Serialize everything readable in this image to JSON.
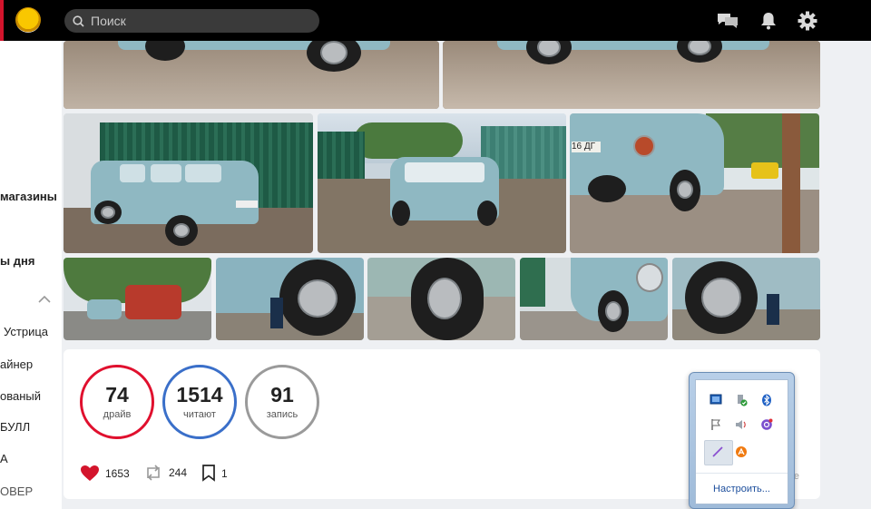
{
  "topbar": {
    "search_placeholder": "Поиск",
    "icons": [
      "logo-icon",
      "search-icon",
      "messages-icon",
      "bell-icon",
      "gear-icon"
    ]
  },
  "sidebar": {
    "items": [
      {
        "label": "магазины",
        "bold": true
      },
      {
        "label": "ы дня",
        "bold": true
      },
      {
        "label": "Устрица"
      },
      {
        "label": "айнер"
      },
      {
        "label": "ованый"
      },
      {
        "label": "БУЛЛ"
      },
      {
        "label": "А"
      },
      {
        "label": "ОВЕР"
      }
    ]
  },
  "gallery": {
    "photos": [
      "photo-car-top-left",
      "photo-car-top-right",
      "photo-car-fence-side",
      "photo-car-front-yard",
      "photo-car-rear",
      "photo-street-van",
      "photo-wheel-1",
      "photo-wheel-2",
      "photo-wheel-3",
      "photo-headlight",
      "photo-wheel-4"
    ],
    "plates": [
      "16 ДГ"
    ]
  },
  "stats": {
    "drives": {
      "value": "74",
      "label": "драйв",
      "color": "#e0102e"
    },
    "readers": {
      "value": "1514",
      "label": "читают",
      "color": "#3a6fc9"
    },
    "entries": {
      "value": "91",
      "label": "запись",
      "color": "#9a9a9a"
    }
  },
  "actions": {
    "likes": "1653",
    "reposts": "244",
    "bookmarks": "1",
    "ghost_text": "те"
  },
  "tray": {
    "configure_label": "Настроить..."
  }
}
